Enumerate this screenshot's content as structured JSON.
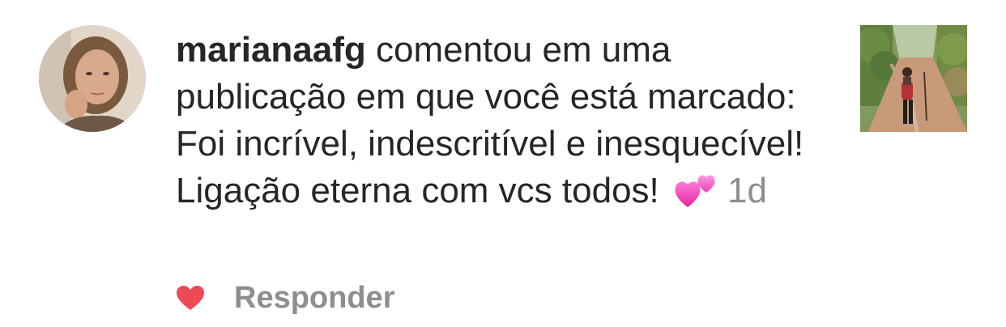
{
  "notification": {
    "username": "mariana",
    "username_suffix": "afg",
    "action_text": " comentou em uma publicação em que você está marcado: ",
    "comment": "Foi incrível, indescritível e inesquecível! Ligação eterna com vcs todos! ",
    "emoji": "two-hearts-emoji",
    "timestamp": "1d",
    "avatar_icon": "user-avatar",
    "thumbnail_icon": "post-thumbnail"
  },
  "actions": {
    "like_icon": "heart-icon",
    "like_color": "#ed4956",
    "reply_label": "Responder"
  },
  "colors": {
    "text": "#262626",
    "muted": "#8e8e8e"
  }
}
